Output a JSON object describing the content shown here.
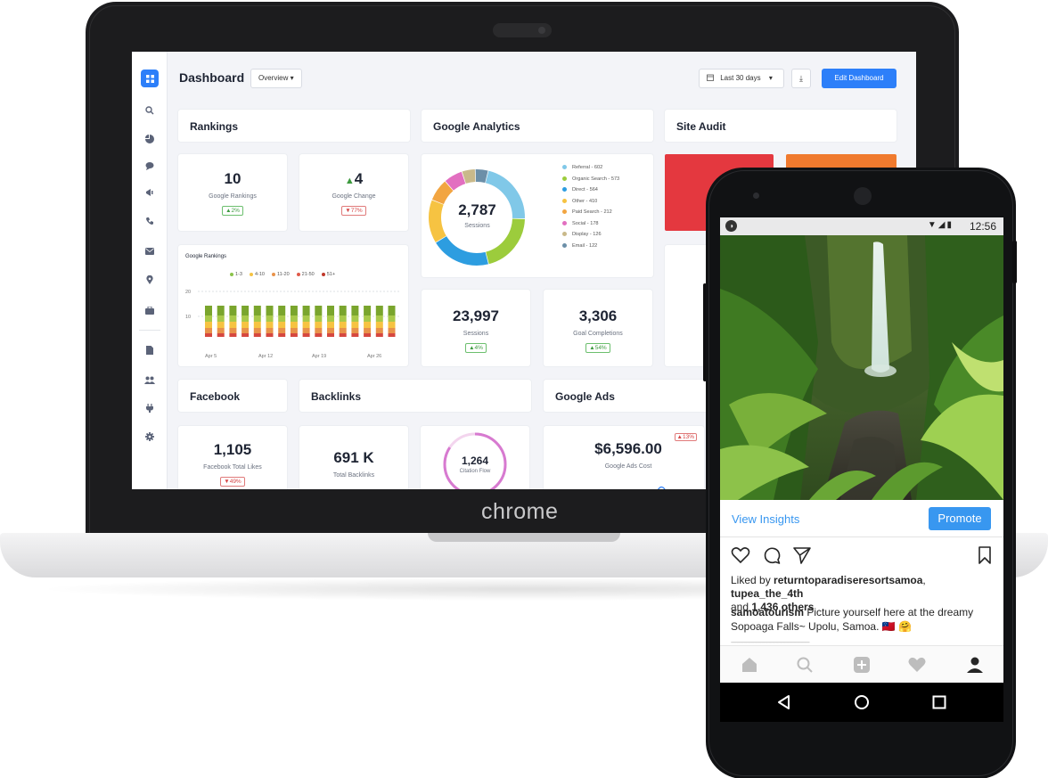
{
  "laptop": {
    "brand": "chrome",
    "dashboard": {
      "title": "Dashboard",
      "view_select": "Overview ▾",
      "date_range": "Last 30 days",
      "date_caret": "▾",
      "download_icon": "download-icon",
      "edit_button": "Edit Dashboard",
      "sidebar_icons": [
        "grid-icon",
        "search-icon",
        "pie-icon",
        "chat-icon",
        "megaphone-icon",
        "phone-icon",
        "mail-icon",
        "location-icon",
        "briefcase-icon",
        "document-icon",
        "users-icon",
        "plug-icon",
        "gear-icon"
      ],
      "sections": {
        "rankings": "Rankings",
        "google_analytics": "Google Analytics",
        "site_audit": "Site Audit",
        "facebook": "Facebook",
        "backlinks": "Backlinks",
        "google_ads": "Google Ads"
      },
      "google_rankings": {
        "value": "10",
        "label": "Google Rankings",
        "badge": "▲2%"
      },
      "google_change": {
        "value": "▲4",
        "label": "Google Change",
        "badge": "▼77%"
      },
      "rank_chart": {
        "title": "Google Rankings",
        "legend": [
          "1-3",
          "4-10",
          "11-20",
          "21-50",
          "51+"
        ],
        "legend_colors": [
          "#8bc34a",
          "#f6c342",
          "#e8924a",
          "#e05a4a",
          "#c0392b"
        ],
        "y_ticks": [
          "20",
          "10"
        ],
        "x_ticks": [
          "Apr 5",
          "Apr 12",
          "Apr 19",
          "Apr 26"
        ]
      },
      "analytics": {
        "total": "2,787",
        "total_label": "Sessions",
        "legend": [
          {
            "label": "Referral - 602",
            "color": "#80c8e8"
          },
          {
            "label": "Organic Search - 573",
            "color": "#9ccc3c"
          },
          {
            "label": "Direct - 564",
            "color": "#2d9de0"
          },
          {
            "label": "Other - 410",
            "color": "#f6c342"
          },
          {
            "label": "Paid Search - 212",
            "color": "#f2a541"
          },
          {
            "label": "Social - 178",
            "color": "#e26fc0"
          },
          {
            "label": "Display - 126",
            "color": "#c9b98a"
          },
          {
            "label": "Email - 122",
            "color": "#6c8fa8"
          }
        ]
      },
      "sessions": {
        "value": "23,997",
        "label": "Sessions",
        "badge": "▲4%"
      },
      "goal_completions": {
        "value": "3,306",
        "label": "Goal Completions",
        "badge": "▲54%"
      },
      "facebook": {
        "value": "1,105",
        "label": "Facebook Total Likes",
        "badge": "▼49%"
      },
      "backlinks": {
        "value": "691 K",
        "label": "Total Backlinks"
      },
      "citation": {
        "value": "1,264",
        "label": "Citation Flow"
      },
      "ads": {
        "value": "$6,596.00",
        "label": "Google Ads Cost",
        "badge": "▲13%"
      }
    }
  },
  "phone": {
    "status": {
      "time": "12:56",
      "icons": "▼◢▮"
    },
    "view_insights": "View Insights",
    "promote": "Promote",
    "likes_prefix": "Liked by ",
    "likes_user": "returntoparadiseresortsamoa",
    "likes_sep": ", ",
    "likes_user2": "tupea_the_4th",
    "likes_and": "and ",
    "likes_count": "1,436 others",
    "caption_user": "samoatourism",
    "caption_text": " Picture yourself here at the dreamy Sopoaga Falls~ Upolu, Samoa. 🇼🇸 🤗",
    "divider": "------------------------------------------------------------------",
    "nav_icons": [
      "home-icon",
      "search-icon",
      "add-icon",
      "heart-icon",
      "profile-icon"
    ]
  }
}
